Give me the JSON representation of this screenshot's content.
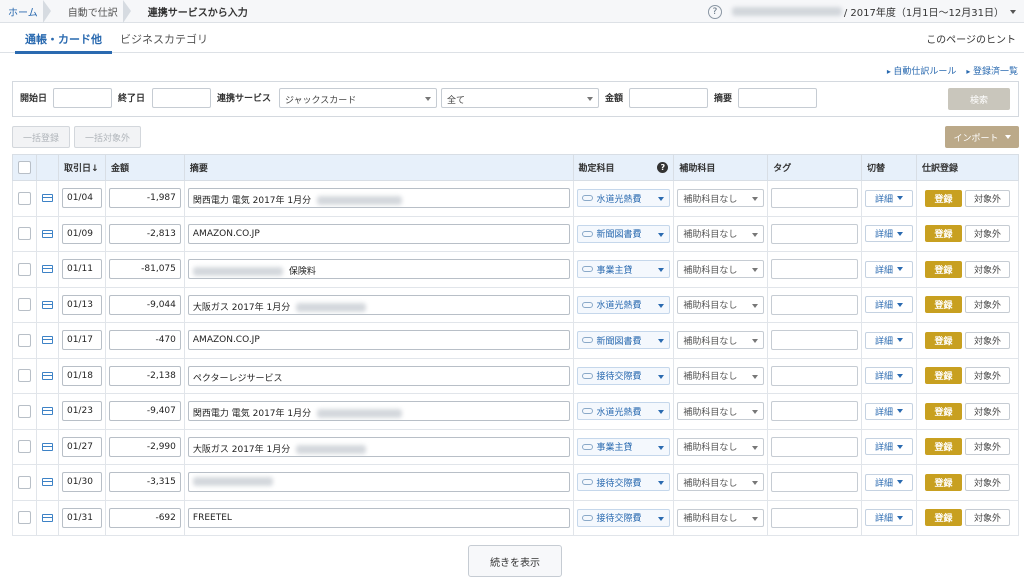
{
  "breadcrumb": {
    "home": "ホーム",
    "step1": "自動で仕訳",
    "current": "連携サービスから入力"
  },
  "header": {
    "help_label": "?",
    "fiscal_year": "/ 2017年度（1月1日〜12月31日）"
  },
  "tabs": {
    "active": "通帳・カード他",
    "second": "ビジネスカテゴリ",
    "hint": "このページのヒント"
  },
  "links": {
    "auto_rule": "自動仕訳ルール",
    "registered": "登録済一覧"
  },
  "filter": {
    "start_label": "開始日",
    "end_label": "終了日",
    "service_label": "連携サービス",
    "service_value": "ジャックスカード",
    "account_value": "全て",
    "amount_label": "金額",
    "memo_label": "摘要",
    "search_button": "検索"
  },
  "actions": {
    "bulk_register": "一括登録",
    "bulk_exclude": "一括対象外",
    "import": "インポート"
  },
  "columns": {
    "date": "取引日",
    "sort_icon": "↓",
    "amount": "金額",
    "memo": "摘要",
    "account": "勘定科目",
    "account_help": "?",
    "sub_account": "補助科目",
    "tag": "タグ",
    "toggle": "切替",
    "register": "仕訳登録"
  },
  "row_labels": {
    "sub_none": "補助科目なし",
    "detail": "詳細",
    "register": "登録",
    "exclude": "対象外"
  },
  "rows": [
    {
      "date": "01/04",
      "amount": "-1,987",
      "memo": "関西電力 電気 2017年 1月分",
      "blur_w": 85,
      "account": "水道光熱費"
    },
    {
      "date": "01/09",
      "amount": "-2,813",
      "memo": "AMAZON.CO.JP",
      "blur_w": 0,
      "account": "新聞図書費"
    },
    {
      "date": "01/11",
      "amount": "-81,075",
      "memo": "保険料",
      "blur_w": 0,
      "lead_blur": 90,
      "account": "事業主貸"
    },
    {
      "date": "01/13",
      "amount": "-9,044",
      "memo": "大阪ガス 2017年 1月分",
      "blur_w": 70,
      "account": "水道光熱費"
    },
    {
      "date": "01/17",
      "amount": "-470",
      "memo": "AMAZON.CO.JP",
      "blur_w": 0,
      "account": "新聞図書費"
    },
    {
      "date": "01/18",
      "amount": "-2,138",
      "memo": "ペクターレジサービス",
      "blur_w": 0,
      "account": "接待交際費"
    },
    {
      "date": "01/23",
      "amount": "-9,407",
      "memo": "関西電力 電気 2017年 1月分",
      "blur_w": 85,
      "account": "水道光熱費"
    },
    {
      "date": "01/27",
      "amount": "-2,990",
      "memo": "大阪ガス 2017年 1月分",
      "blur_w": 70,
      "account": "事業主貸"
    },
    {
      "date": "01/30",
      "amount": "-3,315",
      "memo": "",
      "blur_w": 0,
      "lead_blur": 80,
      "account": "接待交際費"
    },
    {
      "date": "01/31",
      "amount": "-692",
      "memo": "FREETEL",
      "blur_w": 0,
      "account": "接待交際費"
    }
  ],
  "more_button": "続きを表示"
}
